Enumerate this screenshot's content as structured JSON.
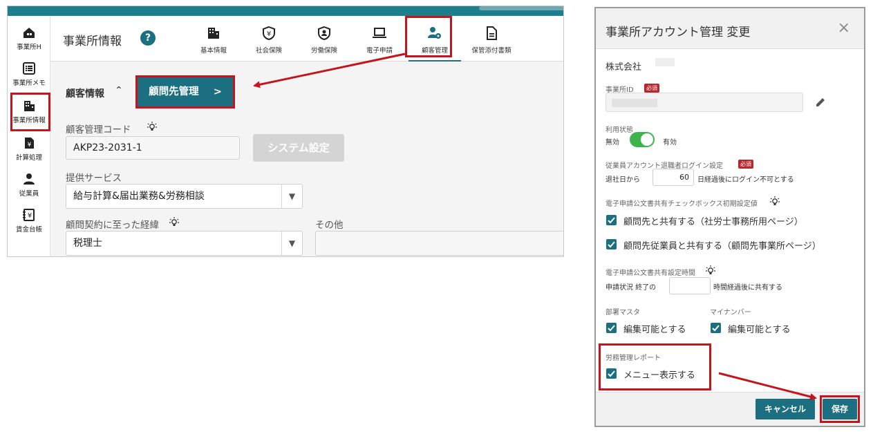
{
  "left_app": {
    "sidebar": [
      {
        "label": "事業所H",
        "icon": "home-building-icon"
      },
      {
        "label": "事業所メモ",
        "icon": "memo-list-icon"
      },
      {
        "label": "事業所情報",
        "icon": "building-icon"
      },
      {
        "label": "計算処理",
        "icon": "yen-document-icon"
      },
      {
        "label": "従業員",
        "icon": "person-icon"
      },
      {
        "label": "賃金台帳",
        "icon": "yen-book-icon"
      }
    ],
    "page_title": "事業所情報",
    "help_glyph": "?",
    "tabs": [
      {
        "label": "基本情報",
        "icon": "building-icon"
      },
      {
        "label": "社会保険",
        "icon": "yen-shield-icon"
      },
      {
        "label": "労働保険",
        "icon": "person-shield-icon"
      },
      {
        "label": "電子申請",
        "icon": "laptop-icon"
      },
      {
        "label": "顧客管理",
        "icon": "user-gear-icon"
      },
      {
        "label": "保管添付書類",
        "icon": "document-icon"
      }
    ],
    "section": {
      "title": "顧客情報",
      "collapse_glyph": "^",
      "advisor_button": "顧問先管理",
      "advisor_button_chevron": ">"
    },
    "fields": {
      "customer_code_label": "顧客管理コード",
      "customer_code_value": "AKP23-2031-1",
      "system_settings_button": "システム設定",
      "service_label": "提供サービス",
      "service_value": "給与計算&届出業務&労務相談",
      "contract_reason_label": "顧問契約に至った経緯",
      "contract_reason_value": "税理士",
      "other_label": "その他",
      "other_value": ""
    }
  },
  "dialog": {
    "title": "事業所アカウント管理 変更",
    "close_glyph": "×",
    "company_name": "株式会社",
    "office_id_label": "事業所ID",
    "required_badge": "必須",
    "usage_label": "利用状態",
    "usage_off": "無効",
    "usage_on": "有効",
    "usage_enabled": true,
    "retiree_login_label": "従業員アカウント退職者ログイン設定",
    "retiree_prefix": "退社日から",
    "retiree_days": "60",
    "retiree_suffix": "日経過後にログイン不可とする",
    "e_app_checkbox_label": "電子申請公文書共有チェックボックス初期設定値",
    "share_advisor": "顧問先と共有する（社労士事務所用ページ）",
    "share_advisor_employee": "顧問先従業員と共有する（顧問先事業所ページ）",
    "e_app_time_label": "電子申請公文書共有設定時間",
    "share_time_prefix": "申請状況 終了の",
    "share_time_value": "",
    "share_time_suffix": "時間経過後に共有する",
    "dept_master_label": "部署マスタ",
    "dept_master_option": "編集可能とする",
    "my_number_label": "マイナンバー",
    "my_number_option": "編集可能とする",
    "labor_report_label": "労務管理レポート",
    "labor_report_option": "メニュー表示する",
    "cancel_button": "キャンセル",
    "save_button": "保存"
  },
  "colors": {
    "brand_teal": "#1b6f80",
    "topbar": "#1b7f8c",
    "highlight_red": "#c4141c",
    "required_red": "#b8272d",
    "toggle_green": "#3bb54a"
  }
}
